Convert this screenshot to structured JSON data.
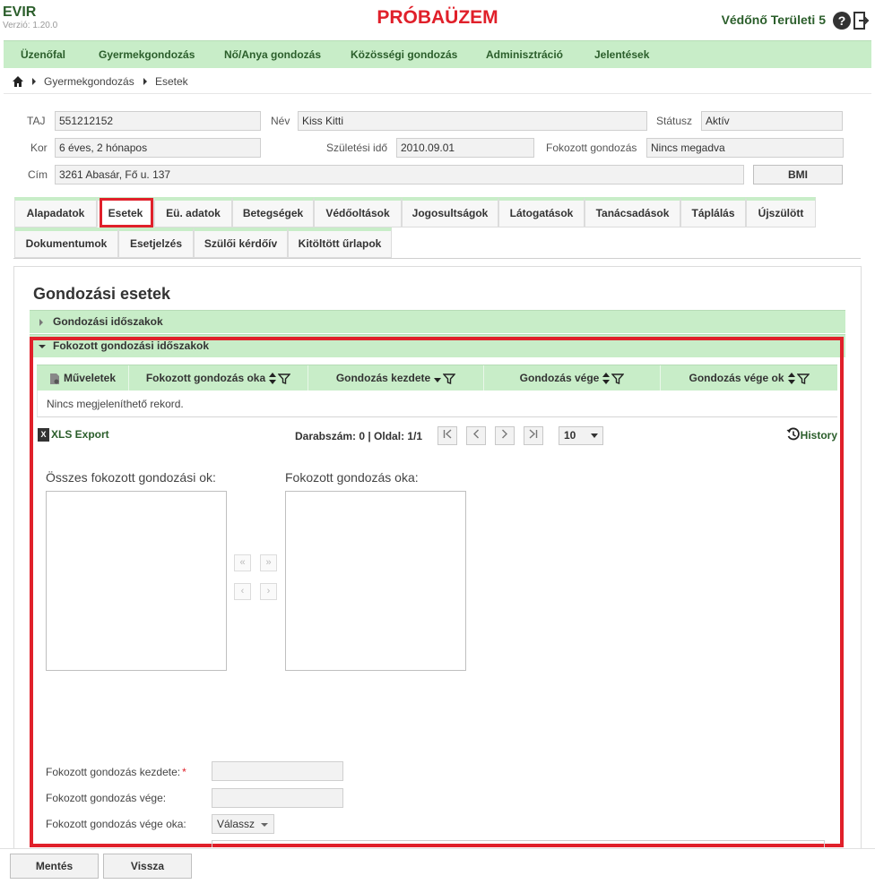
{
  "header": {
    "app_name": "EVIR",
    "version": "Verzió: 1.20.0",
    "test_banner": "PRÓBAÜZEM",
    "user": "Védőnő Területi 5",
    "help": "?"
  },
  "menu": [
    "Üzenőfal",
    "Gyermekgondozás",
    "Nő/Anya gondozás",
    "Közösségi gondozás",
    "Adminisztráció",
    "Jelentések"
  ],
  "breadcrumb": [
    "Gyermekgondozás",
    "Esetek"
  ],
  "patient": {
    "taj_label": "TAJ",
    "taj": "551212152",
    "name_label": "Név",
    "name": "Kiss Kitti",
    "status_label": "Státusz",
    "status": "Aktív",
    "age_label": "Kor",
    "age": "6 éves, 2 hónapos",
    "birth_label": "Születési idő",
    "birth": "2010.09.01",
    "care_label": "Fokozott gondozás",
    "care": "Nincs megadva",
    "address_label": "Cím",
    "address": "3261 Abasár, Fő u. 137",
    "bmi": "BMI"
  },
  "tabs_row1": [
    "Alapadatok",
    "Esetek",
    "Eü. adatok",
    "Betegségek",
    "Védőoltások",
    "Jogosultságok",
    "Látogatások",
    "Tanácsadások",
    "Táplálás",
    "Újszülött"
  ],
  "tabs_row2": [
    "Dokumentumok",
    "Esetjelzés",
    "Szülői kérdőív",
    "Kitöltött űrlapok"
  ],
  "active_tab": "Esetek",
  "section_title": "Gondozási esetek",
  "accordions": {
    "periods": "Gondozási időszakok",
    "intensive": "Fokozott gondozási időszakok"
  },
  "grid": {
    "columns": [
      "Műveletek",
      "Fokozott gondozás oka",
      "Gondozás kezdete",
      "Gondozás vége",
      "Gondozás vége ok"
    ],
    "empty": "Nincs megjeleníthető rekord."
  },
  "toolbar": {
    "xls": "XLS Export",
    "xls_icon": "X",
    "count": "Darabszám: 0 | Oldal: 1/1",
    "page_size": "10",
    "history": "History",
    "pager": {
      "first": "⏮",
      "prev": "‹",
      "next": "›",
      "last": "⏭"
    }
  },
  "picklist": {
    "all_label": "Összes fokozott gondozási ok:",
    "selected_label": "Fokozott gondozás oka:",
    "buttons": {
      "all_left": "«",
      "all_right": "»",
      "left": "‹",
      "right": "›"
    }
  },
  "form": {
    "start_label": "Fokozott gondozás kezdete:",
    "required_mark": "*",
    "end_label": "Fokozott gondozás vége:",
    "end_reason_label": "Fokozott gondozás vége oka:",
    "end_reason_value": "Válassz"
  },
  "footer": {
    "save": "Mentés",
    "back": "Vissza"
  },
  "colors": {
    "accent_green": "#c8edc8",
    "brand_green": "#2b5e2b",
    "alert_red": "#e0202a"
  }
}
